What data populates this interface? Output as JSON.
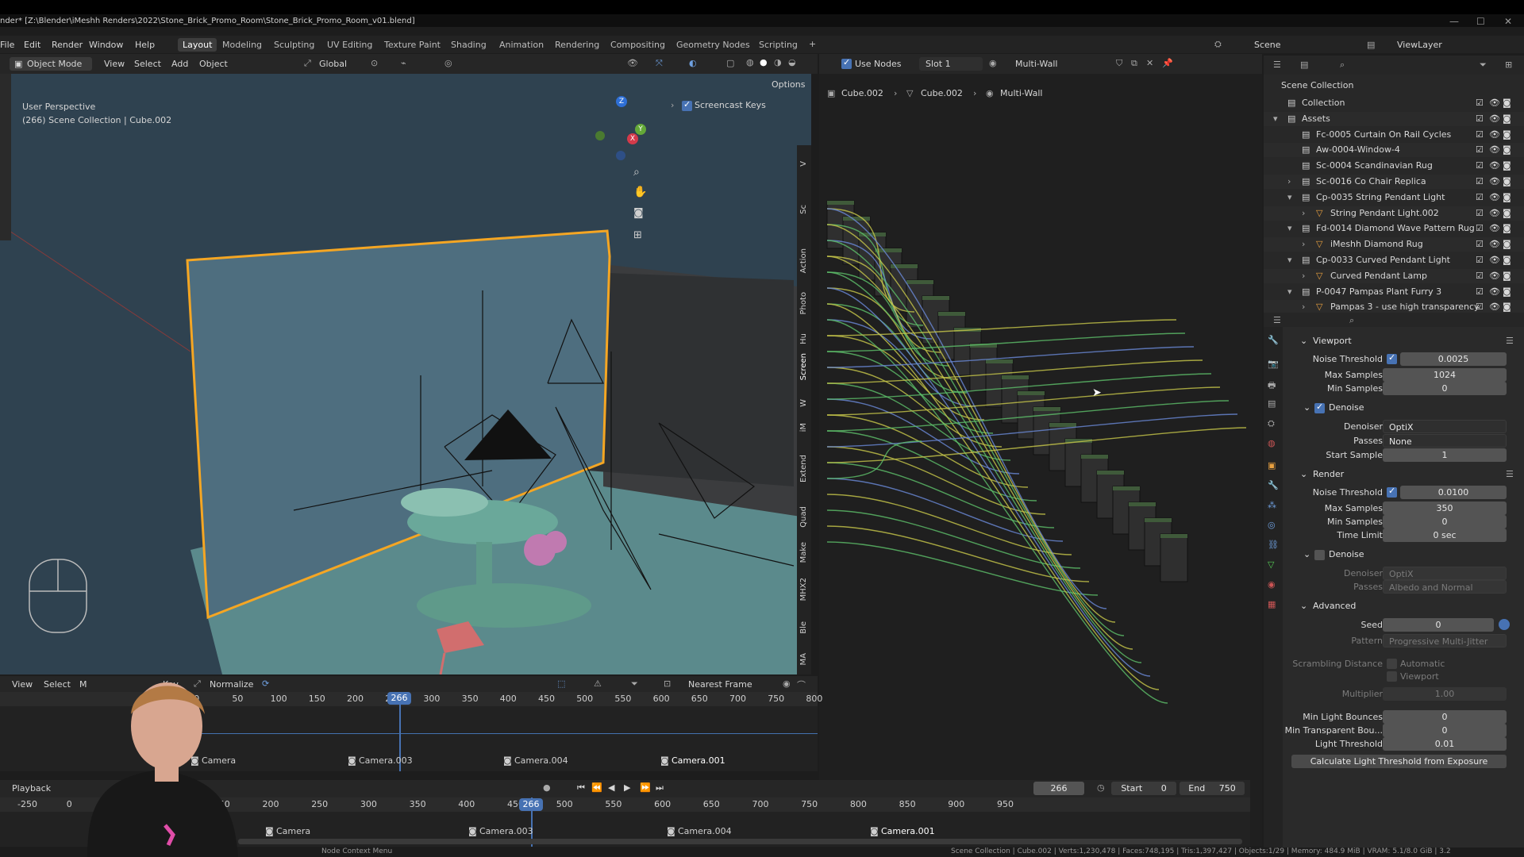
{
  "window": {
    "title": "nder* [Z:\\Blender\\iMeshh Renders\\2022\\Stone_Brick_Promo_Room\\Stone_Brick_Promo_Room_v01.blend]"
  },
  "menu": [
    "File",
    "Edit",
    "Render",
    "Window",
    "Help"
  ],
  "workspaces": [
    "Layout",
    "Modeling",
    "Sculpting",
    "UV Editing",
    "Texture Paint",
    "Shading",
    "Animation",
    "Rendering",
    "Compositing",
    "Geometry Nodes",
    "Scripting",
    "+"
  ],
  "scene": {
    "label": "Scene",
    "view_layer": "ViewLayer"
  },
  "viewport": {
    "mode": "Object Mode",
    "menu": [
      "View",
      "Select",
      "Add",
      "Object"
    ],
    "orientation": "Global",
    "options": "Options",
    "perspective": "User Perspective",
    "collection_info": "(266) Scene Collection | Cube.002",
    "screencast_keys": "Screencast Keys",
    "side_tabs": [
      "Action",
      "Photo",
      "Hu",
      "Screen",
      "W",
      "iM",
      "Extend",
      "Quad",
      "Make",
      "MHX2",
      "Ble",
      "MA",
      "Sc",
      "V"
    ]
  },
  "node_editor": {
    "use_nodes": "Use Nodes",
    "slot": "Slot 1",
    "material": "Multi-Wall",
    "breadcrumb": [
      "Cube.002",
      "Cube.002",
      "Multi-Wall"
    ]
  },
  "outliner": {
    "root": "Scene Collection",
    "items": [
      {
        "label": "Collection"
      },
      {
        "label": "Assets"
      },
      {
        "label": "Fc-0005 Curtain On Rail Cycles"
      },
      {
        "label": "Aw-0004-Window-4"
      },
      {
        "label": "Sc-0004 Scandinavian Rug"
      },
      {
        "label": "Sc-0016 Co Chair Replica"
      },
      {
        "label": "Cp-0035 String Pendant Light"
      },
      {
        "label": "String Pendant Light.002"
      },
      {
        "label": "Fd-0014 Diamond Wave Pattern Rug"
      },
      {
        "label": "iMeshh Diamond Rug"
      },
      {
        "label": "Cp-0033 Curved Pendant Light"
      },
      {
        "label": "Curved Pendant Lamp"
      },
      {
        "label": "P-0047 Pampas Plant Furry 3"
      },
      {
        "label": "Pampas 3 - use high transparency"
      }
    ]
  },
  "properties": {
    "viewport": {
      "title": "Viewport",
      "noise_threshold_label": "Noise Threshold",
      "noise_threshold": "0.0025",
      "max_samples_label": "Max Samples",
      "max_samples": "1024",
      "min_samples_label": "Min Samples",
      "min_samples": "0",
      "denoise_label": "Denoise",
      "denoiser_label": "Denoiser",
      "denoiser": "OptiX",
      "passes_label": "Passes",
      "passes": "None",
      "start_sample_label": "Start Sample",
      "start_sample": "1"
    },
    "render": {
      "title": "Render",
      "noise_threshold_label": "Noise Threshold",
      "noise_threshold": "0.0100",
      "max_samples_label": "Max Samples",
      "max_samples": "350",
      "min_samples_label": "Min Samples",
      "min_samples": "0",
      "time_limit_label": "Time Limit",
      "time_limit": "0 sec",
      "denoise_label": "Denoise",
      "denoiser_label": "Denoiser",
      "denoiser": "OptiX",
      "passes_label": "Passes",
      "passes": "Albedo and Normal"
    },
    "advanced": {
      "title": "Advanced",
      "seed_label": "Seed",
      "seed": "0",
      "pattern_label": "Pattern",
      "pattern": "Progressive Multi-Jitter",
      "scrambling_label": "Scrambling Distance",
      "automatic_label": "Automatic",
      "viewport_label": "Viewport",
      "multiplier_label": "Multiplier",
      "multiplier": "1.00",
      "min_light_bounces_label": "Min Light Bounces",
      "min_light_bounces": "0",
      "min_transparent_label": "Min Transparent Bou...",
      "min_transparent": "0",
      "light_threshold_label": "Light Threshold",
      "light_threshold": "0.01",
      "calc_button": "Calculate Light Threshold from Exposure"
    }
  },
  "timeline_top": {
    "menu": [
      "View",
      "Select",
      "M",
      "Key"
    ],
    "normalize": "Normalize",
    "snap": "Nearest Frame",
    "current_frame": "266",
    "ticks": [
      "50",
      "0",
      "50",
      "100",
      "150",
      "200",
      "250",
      "300",
      "350",
      "400",
      "450",
      "500",
      "550",
      "600",
      "650",
      "700",
      "750",
      "800"
    ],
    "markers": [
      "Camera",
      "Camera.003",
      "Camera.004",
      "Camera.001"
    ]
  },
  "timeline_bottom": {
    "playback": "Playback",
    "frame": "266",
    "start_label": "Start",
    "start": "0",
    "end_label": "End",
    "end": "750",
    "current_frame": "266",
    "ticks": [
      "-250",
      "0",
      "50",
      "100",
      "150",
      "200",
      "250",
      "300",
      "350",
      "400",
      "450",
      "500",
      "550",
      "600",
      "650",
      "700",
      "750",
      "800",
      "850",
      "900",
      "950"
    ],
    "markers": [
      "Camera",
      "Camera.003",
      "Camera.004",
      "Camera.001"
    ]
  },
  "statusbar": {
    "left": "Node Context Menu",
    "right": "Scene Collection | Cube.002 | Verts:1,230,478 | Faces:748,195 | Tris:1,397,427 | Objects:1/29 | Memory: 484.9 MiB | VRAM: 5.1/8.0 GiB | 3.2"
  },
  "colors": {
    "accent": "#4772b3",
    "selection": "#f5a623",
    "viewport_bg": "#2b3b47",
    "wall": "#4e6e7f"
  }
}
